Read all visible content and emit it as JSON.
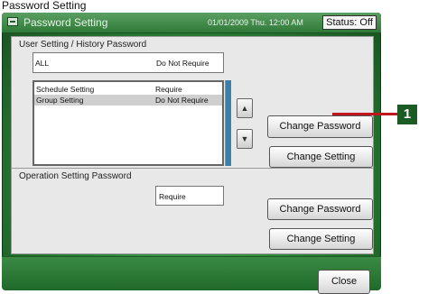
{
  "caption": "Password Setting",
  "title": "Password Setting",
  "datetime": "01/01/2009 Thu. 12:00 AM",
  "status": "Status: Off",
  "user_section": {
    "label": "User Setting / History Password",
    "all_row": {
      "name": "ALL",
      "value": "Do Not Require"
    },
    "rows": [
      {
        "name": "Schedule Setting",
        "value": "Require"
      },
      {
        "name": "Group Setting",
        "value": "Do Not Require"
      }
    ],
    "up_arrow": "▲",
    "down_arrow": "▼",
    "change_password_label": "Change Password",
    "change_setting_label": "Change Setting"
  },
  "op_section": {
    "label": "Operation Setting Password",
    "value": "Require",
    "change_password_label": "Change Password",
    "change_setting_label": "Change Setting"
  },
  "close_label": "Close",
  "callout_number": "1"
}
